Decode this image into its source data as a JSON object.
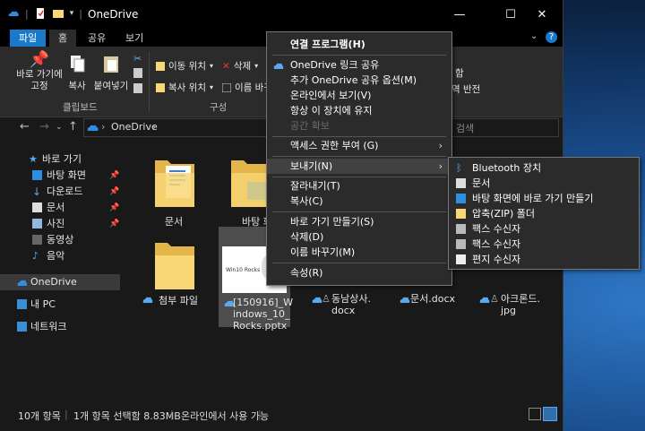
{
  "window": {
    "title": "OneDrive",
    "minimize": "—",
    "maximize": "☐",
    "close": "✕"
  },
  "tabs": [
    {
      "label": "파일"
    },
    {
      "label": "홈"
    },
    {
      "label": "공유"
    },
    {
      "label": "보기"
    }
  ],
  "ribbon": {
    "pin_label": "바로 가기에\n고정",
    "copy_label": "복사",
    "paste_label": "붙여넣기",
    "clipboard_group": "클립보드",
    "move_to": "이동 위치",
    "delete": "삭제",
    "copy_to": "복사 위치",
    "rename": "이름 바꾸기",
    "organize_group": "구성",
    "right_a": "함",
    "right_b": "역 반전"
  },
  "address": {
    "path": "OneDrive",
    "search_placeholder": "검색"
  },
  "nav": [
    {
      "label": "바로 가기"
    },
    {
      "label": "바탕 화면"
    },
    {
      "label": "다운로드"
    },
    {
      "label": "문서"
    },
    {
      "label": "사진"
    },
    {
      "label": "동영상"
    },
    {
      "label": "음악"
    },
    {
      "label": "OneDrive"
    },
    {
      "label": "내 PC"
    },
    {
      "label": "네트워크"
    }
  ],
  "files": [
    {
      "label": "문서"
    },
    {
      "label": "바탕 화"
    },
    {
      "label": "첨부 파일"
    },
    {
      "label": "[150916]_W\nindows_10_\nRocks.pptx"
    },
    {
      "label": "동남상사.\ndocx"
    },
    {
      "label": "문서.docx"
    },
    {
      "label": "아크론드.\njpg"
    }
  ],
  "status": {
    "count": "10개 항목",
    "selected": "1개 항목 선택함 8.83MB",
    "availability": "온라인에서 사용 가능"
  },
  "context_menu": [
    {
      "label": "연결 프로그램(H)"
    },
    {
      "label": "OneDrive 링크 공유"
    },
    {
      "label": "추가 OneDrive 공유 옵션(M)"
    },
    {
      "label": "온라인에서 보기(V)"
    },
    {
      "label": "항상 이 장치에 유지"
    },
    {
      "label": "공간 확보"
    },
    {
      "label": "액세스 권한 부여 (G)"
    },
    {
      "label": "보내기(N)"
    },
    {
      "label": "잘라내기(T)"
    },
    {
      "label": "복사(C)"
    },
    {
      "label": "바로 가기 만들기(S)"
    },
    {
      "label": "삭제(D)"
    },
    {
      "label": "이름 바꾸기(M)"
    },
    {
      "label": "속성(R)"
    }
  ],
  "send_to": [
    {
      "label": "Bluetooth 장치"
    },
    {
      "label": "문서"
    },
    {
      "label": "바탕 화면에 바로 가기 만들기"
    },
    {
      "label": "압축(ZIP) 폴더"
    },
    {
      "label": "팩스 수신자"
    },
    {
      "label": "팩스 수신자"
    },
    {
      "label": "편지 수신자"
    }
  ],
  "colors": {
    "accent": "#1979ca",
    "folder": "#f8d775",
    "onedrive": "#2f8ee0"
  }
}
